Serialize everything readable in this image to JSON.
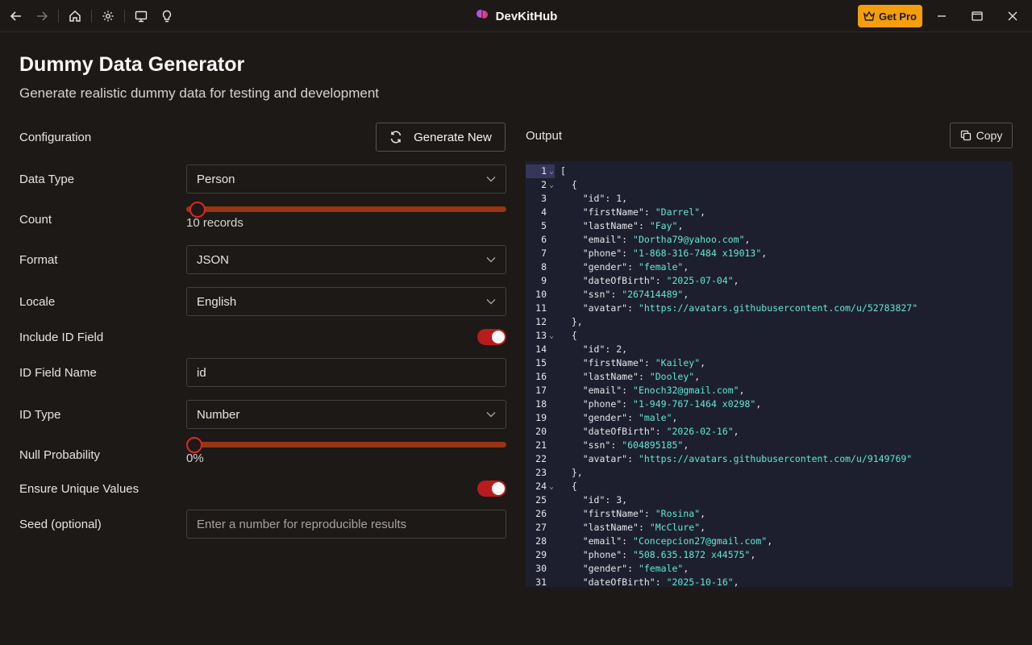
{
  "app": {
    "title": "DevKitHub",
    "get_pro_label": "Get Pro"
  },
  "page": {
    "title": "Dummy Data Generator",
    "subtitle": "Generate realistic dummy data for testing and development"
  },
  "config": {
    "heading": "Configuration",
    "generate_label": "Generate New",
    "fields": {
      "data_type": {
        "label": "Data Type",
        "value": "Person"
      },
      "count": {
        "label": "Count",
        "value_text": "10 records",
        "fraction": 0.01
      },
      "format": {
        "label": "Format",
        "value": "JSON"
      },
      "locale": {
        "label": "Locale",
        "value": "English"
      },
      "include_id": {
        "label": "Include ID Field",
        "on": true
      },
      "id_field_name": {
        "label": "ID Field Name",
        "value": "id"
      },
      "id_type": {
        "label": "ID Type",
        "value": "Number"
      },
      "null_probability": {
        "label": "Null Probability",
        "value_text": "0%",
        "fraction": 0
      },
      "ensure_unique": {
        "label": "Ensure Unique Values",
        "on": true
      },
      "seed": {
        "label": "Seed (optional)",
        "placeholder": "Enter a number for reproducible results",
        "value": ""
      }
    }
  },
  "output": {
    "heading": "Output",
    "copy_label": "Copy",
    "active_line": 1,
    "lines": [
      "[",
      "  {",
      "    \"id\": 1,",
      "    \"firstName\": \"Darrel\",",
      "    \"lastName\": \"Fay\",",
      "    \"email\": \"Dortha79@yahoo.com\",",
      "    \"phone\": \"1-868-316-7484 x19013\",",
      "    \"gender\": \"female\",",
      "    \"dateOfBirth\": \"2025-07-04\",",
      "    \"ssn\": \"267414489\",",
      "    \"avatar\": \"https://avatars.githubusercontent.com/u/52783827\"",
      "  },",
      "  {",
      "    \"id\": 2,",
      "    \"firstName\": \"Kailey\",",
      "    \"lastName\": \"Dooley\",",
      "    \"email\": \"Enoch32@gmail.com\",",
      "    \"phone\": \"1-949-767-1464 x0298\",",
      "    \"gender\": \"male\",",
      "    \"dateOfBirth\": \"2026-02-16\",",
      "    \"ssn\": \"604895185\",",
      "    \"avatar\": \"https://avatars.githubusercontent.com/u/9149769\"",
      "  },",
      "  {",
      "    \"id\": 3,",
      "    \"firstName\": \"Rosina\",",
      "    \"lastName\": \"McClure\",",
      "    \"email\": \"Concepcion27@gmail.com\",",
      "    \"phone\": \"508.635.1872 x44575\",",
      "    \"gender\": \"female\",",
      "    \"dateOfBirth\": \"2025-10-16\","
    ],
    "fold_lines": [
      1,
      2,
      13,
      24
    ]
  },
  "colors": {
    "accent": "#dc2626",
    "pro": "#f59e0b",
    "slider_track": "#9a3412",
    "code_bg": "#1e1f2e",
    "string": "#5eead4"
  }
}
